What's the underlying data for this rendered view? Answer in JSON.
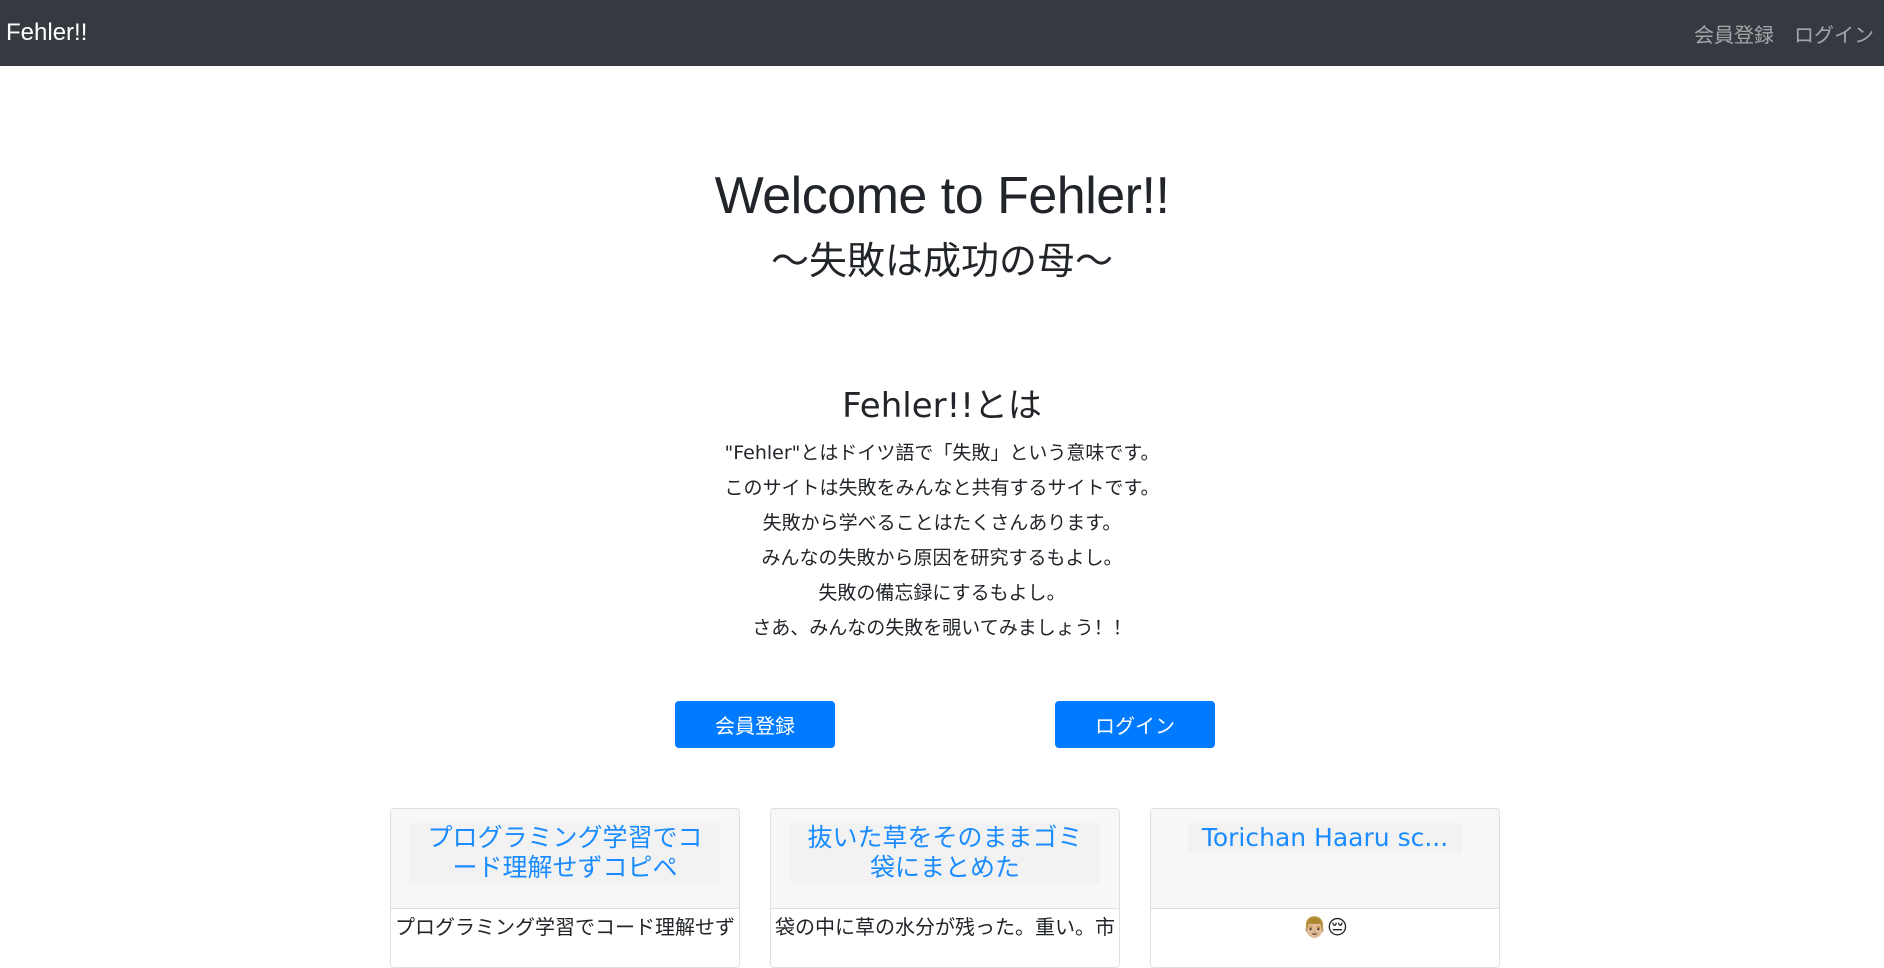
{
  "navbar": {
    "brand": "Fehler!!",
    "links": [
      "会員登録",
      "ログイン"
    ]
  },
  "hero": {
    "title": "Welcome to Fehler!!",
    "subtitle": "〜失敗は成功の母〜"
  },
  "about": {
    "title": "Fehler!!とは",
    "lines": [
      "\"Fehler\"とはドイツ語で「失敗」という意味です。",
      "このサイトは失敗をみんなと共有するサイトです。",
      "失敗から学べることはたくさんあります。",
      "みんなの失敗から原因を研究するもよし。",
      "失敗の備忘録にするもよし。",
      "さあ、みんなの失敗を覗いてみましょう！！"
    ]
  },
  "buttons": {
    "signup": "会員登録",
    "login": "ログイン"
  },
  "cards": [
    {
      "title": "プログラミング学習でコード理解せずコピペ",
      "body": "プログラミング学習でコード理解せず"
    },
    {
      "title": "抜いた草をそのままゴミ袋にまとめた",
      "body": "袋の中に草の水分が残った。重い。市"
    },
    {
      "title": "Torichan Haaru sc...",
      "body": "👨🏼😔"
    }
  ],
  "colors": {
    "navbar_bg": "#343a40",
    "primary": "#007bff",
    "link": "#1a8cff"
  }
}
